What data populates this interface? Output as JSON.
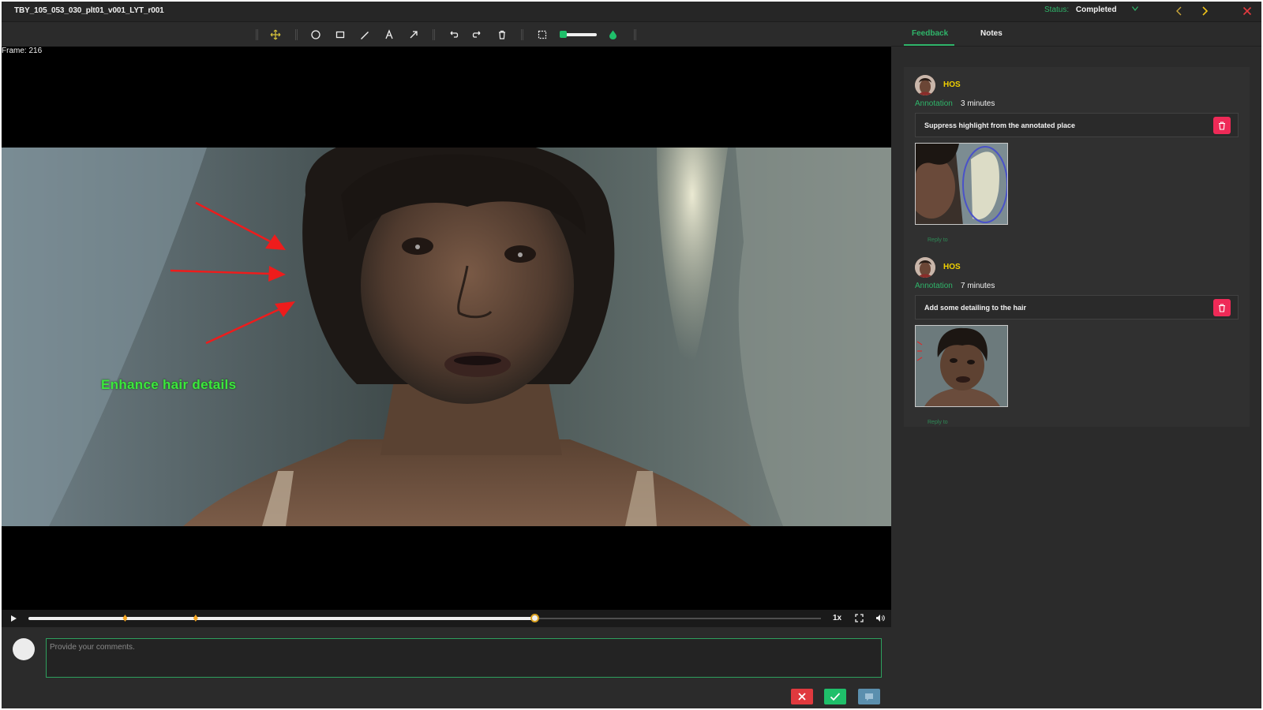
{
  "header": {
    "file_title": "TBY_105_053_030_plt01_v001_LYT_r001",
    "status_label": "Status:",
    "status_value": "Completed"
  },
  "toolbar": {
    "tools": [
      "move-icon",
      "circle-icon",
      "rectangle-icon",
      "pen-icon",
      "text-icon",
      "arrow-icon",
      "undo-icon",
      "redo-icon",
      "trash-icon",
      "select-icon",
      "brush-size-slider",
      "color-drop-icon"
    ],
    "brush_color": "#1fbf6a"
  },
  "viewer": {
    "frame_label": "Frame: 216",
    "annotation_text": "Enhance hair details",
    "annotation_color": "#3ce83c",
    "arrow_color": "#ee1c1c"
  },
  "timeline": {
    "progress": 0.639,
    "markers": [
      0.122,
      0.211
    ],
    "speed": "1x"
  },
  "comment": {
    "placeholder": "Provide your comments."
  },
  "panel": {
    "tabs": [
      {
        "label": "Feedback",
        "active": true
      },
      {
        "label": "Notes",
        "active": false
      }
    ],
    "feedback": [
      {
        "author": "HOS",
        "kind": "Annotation",
        "time": "3 minutes",
        "text": "Suppress highlight from the annotated place",
        "reply": "Reply to"
      },
      {
        "author": "HOS",
        "kind": "Annotation",
        "time": "7 minutes",
        "text": "Add some detailing to the hair",
        "reply": "Reply to"
      }
    ]
  },
  "colors": {
    "accent": "#2fb56a",
    "author": "#f0d000",
    "delete": "#ee2a57",
    "cancel": "#e0393e",
    "submit": "#1fbf6a",
    "comment": "#5b8fae"
  }
}
